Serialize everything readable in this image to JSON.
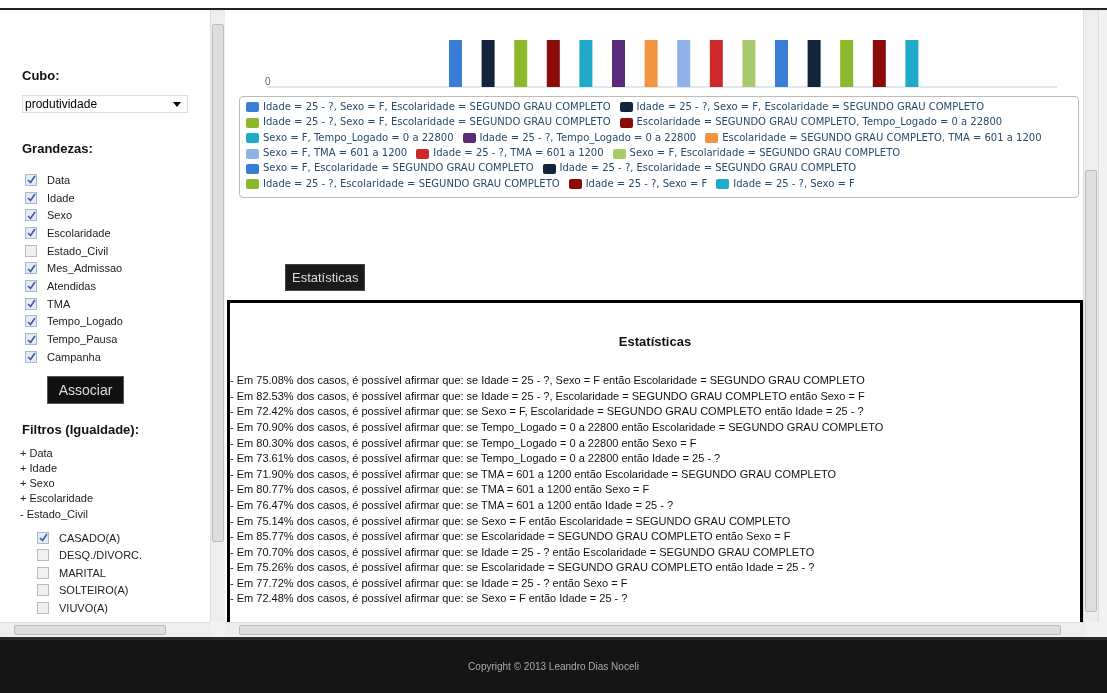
{
  "sidebar": {
    "cube_label": "Cubo:",
    "cube_select": {
      "value": "produtividade"
    },
    "measures_label": "Grandezas:",
    "measures": [
      {
        "label": "Data",
        "checked": true
      },
      {
        "label": "Idade",
        "checked": true
      },
      {
        "label": "Sexo",
        "checked": true
      },
      {
        "label": "Escolaridade",
        "checked": true
      },
      {
        "label": "Estado_Civil",
        "checked": false
      },
      {
        "label": "Mes_Admissao",
        "checked": true
      },
      {
        "label": "Atendidas",
        "checked": true
      },
      {
        "label": "TMA",
        "checked": true
      },
      {
        "label": "Tempo_Logado",
        "checked": true
      },
      {
        "label": "Tempo_Pausa",
        "checked": true
      },
      {
        "label": "Campanha",
        "checked": true
      }
    ],
    "associate_button": "Associar",
    "filters_label": "Filtros (Igualdade):",
    "filters": [
      {
        "label": "+ Data"
      },
      {
        "label": "+ Idade"
      },
      {
        "label": "+ Sexo"
      },
      {
        "label": "+ Escolaridade"
      },
      {
        "label": "- Estado_Civil",
        "children": [
          {
            "label": "CASADO(A)",
            "checked": true
          },
          {
            "label": "DESQ./DIVORC.",
            "checked": false
          },
          {
            "label": "MARITAL",
            "checked": false
          },
          {
            "label": "SOLTEIRO(A)",
            "checked": false
          },
          {
            "label": "VIUVO(A)",
            "checked": false
          }
        ]
      }
    ]
  },
  "chart": {
    "axis_label": "0",
    "legend": [
      {
        "label": "Idade = 25 - ?, Sexo = F, Escolaridade = SEGUNDO GRAU COMPLETO",
        "color": "#3a7dd6"
      },
      {
        "label": "Idade = 25 - ?, Sexo = F, Escolaridade = SEGUNDO GRAU COMPLETO",
        "color": "#13253c"
      },
      {
        "label": "Idade = 25 - ?, Sexo = F, Escolaridade = SEGUNDO GRAU COMPLETO",
        "color": "#8cb82b"
      },
      {
        "label": "Escolaridade = SEGUNDO GRAU COMPLETO, Tempo_Logado = 0 a 22800",
        "color": "#8b0a0a"
      },
      {
        "label": "Sexo = F, Tempo_Logado = 0 a 22800",
        "color": "#20aac9"
      },
      {
        "label": "Idade = 25 - ?, Tempo_Logado = 0 a 22800",
        "color": "#5b2c7c"
      },
      {
        "label": "Escolaridade = SEGUNDO GRAU COMPLETO, TMA = 601 a 1200",
        "color": "#f29340"
      },
      {
        "label": "Sexo = F, TMA = 601 a 1200",
        "color": "#8fb1e8"
      },
      {
        "label": "Idade = 25 - ?, TMA = 601 a 1200",
        "color": "#cc2a2a"
      },
      {
        "label": "Sexo = F, Escolaridade = SEGUNDO GRAU COMPLETO",
        "color": "#a8ca6c"
      },
      {
        "label": "Sexo = F, Escolaridade = SEGUNDO GRAU COMPLETO",
        "color": "#3a7dd6"
      },
      {
        "label": "Idade = 25 - ?, Escolaridade = SEGUNDO GRAU COMPLETO",
        "color": "#13253c"
      },
      {
        "label": "Idade = 25 - ?, Escolaridade = SEGUNDO GRAU COMPLETO",
        "color": "#8cb82b"
      },
      {
        "label": "Idade = 25 - ?, Sexo = F",
        "color": "#8b0a0a"
      },
      {
        "label": "Idade = 25 - ?, Sexo = F",
        "color": "#20aac9"
      }
    ]
  },
  "stats_button": "Estatísticas",
  "stats": {
    "title": "Estatísticas",
    "lines": [
      "- Em 75.08% dos casos, é possível afirmar que: se Idade = 25 - ?, Sexo = F então Escolaridade = SEGUNDO GRAU COMPLETO",
      "- Em 82.53% dos casos, é possível afirmar que: se Idade = 25 - ?, Escolaridade = SEGUNDO GRAU COMPLETO então Sexo = F",
      "- Em 72.42% dos casos, é possível afirmar que: se Sexo = F, Escolaridade = SEGUNDO GRAU COMPLETO então Idade = 25 - ?",
      "- Em 70.90% dos casos, é possível afirmar que: se Tempo_Logado = 0 a 22800 então Escolaridade = SEGUNDO GRAU COMPLETO",
      "- Em 80.30% dos casos, é possível afirmar que: se Tempo_Logado = 0 a 22800 então Sexo = F",
      "- Em 73.61% dos casos, é possível afirmar que: se Tempo_Logado = 0 a 22800 então Idade = 25 - ?",
      "- Em 71.90% dos casos, é possível afirmar que: se TMA = 601 a 1200 então Escolaridade = SEGUNDO GRAU COMPLETO",
      "- Em 80.77% dos casos, é possível afirmar que: se TMA = 601 a 1200 então Sexo = F",
      "- Em 76.47% dos casos, é possível afirmar que: se TMA = 601 a 1200 então Idade = 25 - ?",
      "- Em 75.14% dos casos, é possível afirmar que: se Sexo = F então Escolaridade = SEGUNDO GRAU COMPLETO",
      "- Em 85.77% dos casos, é possível afirmar que: se Escolaridade = SEGUNDO GRAU COMPLETO então Sexo = F",
      "- Em 70.70% dos casos, é possível afirmar que: se Idade = 25 - ? então Escolaridade = SEGUNDO GRAU COMPLETO",
      "- Em 75.26% dos casos, é possível afirmar que: se Escolaridade = SEGUNDO GRAU COMPLETO então Idade = 25 - ?",
      "- Em 77.72% dos casos, é possível afirmar que: se Idade = 25 - ? então Sexo = F",
      "- Em 72.48% dos casos, é possível afirmar que: se Sexo = F então Idade = 25 - ?"
    ]
  },
  "footer": "Copyright © 2013 Leandro Dias Noceli"
}
